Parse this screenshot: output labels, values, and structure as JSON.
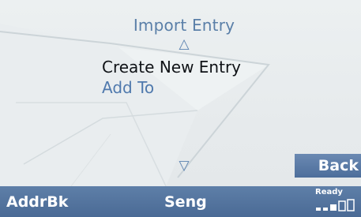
{
  "menu": {
    "title": "Import Entry",
    "scroll_up_icon": "triangle-up-outline",
    "scroll_down_icon": "triangle-down-outline",
    "items": [
      {
        "label": "Create New Entry",
        "selected": true
      },
      {
        "label": "Add To",
        "selected": false
      }
    ]
  },
  "back_button": {
    "label": "Back"
  },
  "status_bar": {
    "left_label": "AddrBk",
    "center_label": "Seng",
    "status_text": "Ready",
    "signal_icon": "signal-strength-icon",
    "signal_level": 0.6
  },
  "colors": {
    "accent_blue": "#5a7fa8",
    "statusbar_blue": "#4f6f99",
    "selected_text": "#0f1216",
    "background": "#eceff1"
  }
}
